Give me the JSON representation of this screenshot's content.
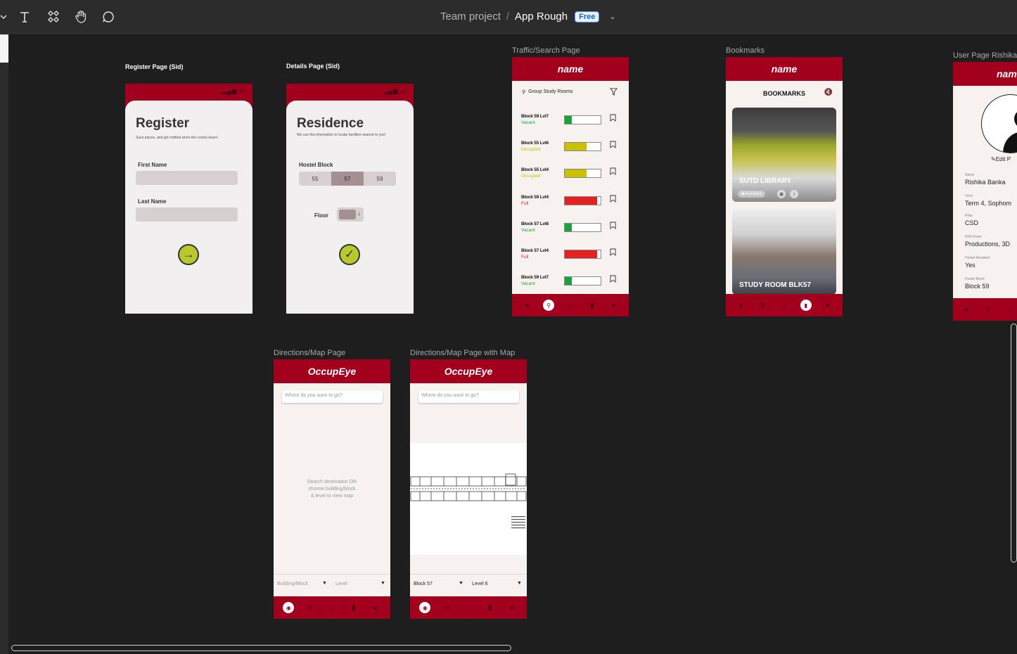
{
  "toolbar": {
    "project": "Team project",
    "separator": "/",
    "file": "App Rough",
    "plan_badge": "Free",
    "tools": [
      "text-tool",
      "components-tool",
      "hand-tool",
      "comment-tool"
    ]
  },
  "frames": {
    "register": {
      "label": "Register Page (Sid)",
      "title": "Register",
      "subtitle": "Save places, and get notified when the crowd clears!",
      "first_name_label": "First Name",
      "last_name_label": "Last Name"
    },
    "details": {
      "label": "Details Page (Sid)",
      "title": "Residence",
      "subtitle": "We use this information to locate facilities nearest to you!",
      "hostel_block_label": "Hostel Block",
      "blocks": [
        "55",
        "57",
        "59"
      ],
      "selected_block": "57",
      "floor_label": "Floor"
    },
    "traffic": {
      "label": "Traffic/Search Page",
      "header": "name",
      "search_text": "Group Study Rooms",
      "items": [
        {
          "name": "Block 59 Lvl7",
          "status": "Vacant",
          "level": 0.2,
          "color": "#1aa33b"
        },
        {
          "name": "Block 55 Lvl6",
          "status": "Occupied",
          "level": 0.6,
          "color": "#c9c000"
        },
        {
          "name": "Block 55 Lvl4",
          "status": "Occupied",
          "level": 0.6,
          "color": "#c9c000"
        },
        {
          "name": "Block 59 Lvl4",
          "status": "Full",
          "level": 0.9,
          "color": "#e42020"
        },
        {
          "name": "Block 57 Lvl8",
          "status": "Vacant",
          "level": 0.2,
          "color": "#1aa33b"
        },
        {
          "name": "Block 57 Lvl4",
          "status": "Full",
          "level": 0.9,
          "color": "#e42020"
        },
        {
          "name": "Block 59 Lvl7",
          "status": "Vacant",
          "level": 0.2,
          "color": "#1aa33b"
        }
      ]
    },
    "bookmarks": {
      "label": "Bookmarks",
      "header": "name",
      "title": "BOOKMARKS",
      "card1_title": "SUTD LIBRARY",
      "card1_chip": "Availability",
      "card2_title": "STUDY ROOM BLK57"
    },
    "user": {
      "label": "User Page Rishika",
      "header": "nam",
      "edit": "Edit P",
      "fields": [
        {
          "label": "Name",
          "value": "Rishika Banka"
        },
        {
          "label": "Term",
          "value": "Term 4, Sophom"
        },
        {
          "label": "Pillar",
          "value": "CSD"
        },
        {
          "label": "Fifth Rows",
          "value": "Productions, 3D"
        },
        {
          "label": "Hostel Resident",
          "value": "Yes"
        },
        {
          "label": "Hostel Block",
          "value": "Block 59"
        }
      ]
    },
    "map1": {
      "label": "Directions/Map Page",
      "header": "OccupEye",
      "search_placeholder": "Where do you want to go?",
      "hint": "Search destination OR\nchoose building/block\n& level to view map",
      "building_placeholder": "Building/Block",
      "level_placeholder": "Level"
    },
    "map2": {
      "label": "Directions/Map Page with Map",
      "header": "OccupEye",
      "search_placeholder": "Where do you want to go?",
      "building_value": "Block 57",
      "level_value": "Level 6"
    }
  },
  "colors": {
    "brand": "#a3001e",
    "canvas": "#1e1e1e",
    "toolbar": "#2c2c2c",
    "accent_button": "#b8c82e"
  }
}
